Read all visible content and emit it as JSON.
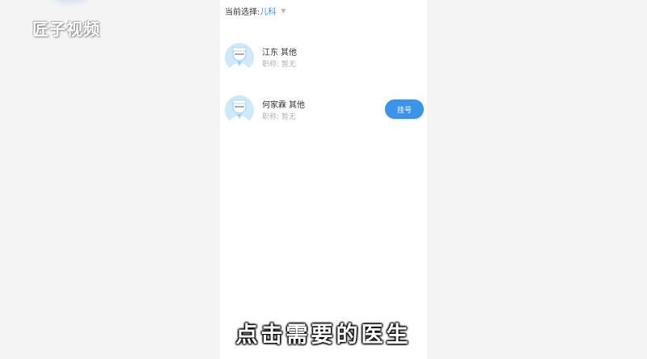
{
  "watermark": "匠子视频",
  "filter": {
    "label": "当前选择:",
    "value": "儿科"
  },
  "doctors": [
    {
      "name": "江东",
      "dept": "其他",
      "title": "职称: 暂无",
      "icon": "doctor-avatar-icon"
    },
    {
      "name": "何家霖",
      "dept": "其他",
      "title": "职称: 暂无",
      "icon": "doctor-avatar-icon",
      "button": "挂号"
    }
  ],
  "subtitle": "点击需要的医生",
  "colors": {
    "accent": "#3c93ea",
    "avatar_bg": "#cfe9f8",
    "background": "#ececec"
  }
}
